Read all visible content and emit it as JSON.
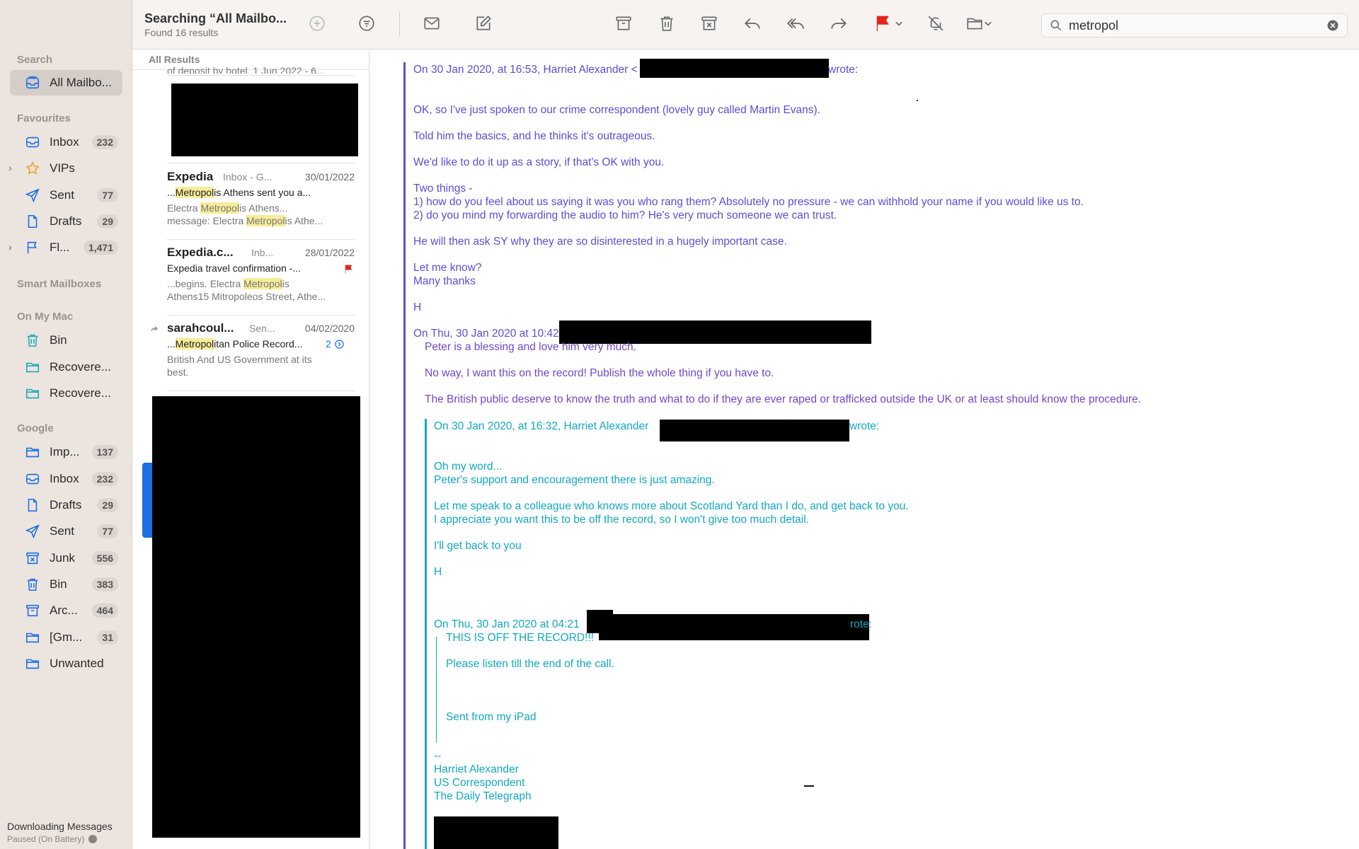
{
  "sidebar": {
    "section_search": "Search",
    "all_mailboxes": "All Mailbo...",
    "section_favourites": "Favourites",
    "fav_inbox": "Inbox",
    "fav_inbox_count": "232",
    "fav_vips": "VIPs",
    "fav_sent": "Sent",
    "fav_sent_count": "77",
    "fav_drafts": "Drafts",
    "fav_drafts_count": "29",
    "fav_flagged": "Fl...",
    "fav_flagged_count": "1,471",
    "section_smart": "Smart Mailboxes",
    "section_mac": "On My Mac",
    "mac_bin": "Bin",
    "mac_recovered1": "Recovere...",
    "mac_recovered2": "Recovere...",
    "section_google": "Google",
    "g_important": "Imp...",
    "g_important_count": "137",
    "g_inbox": "Inbox",
    "g_inbox_count": "232",
    "g_drafts": "Drafts",
    "g_drafts_count": "29",
    "g_sent": "Sent",
    "g_sent_count": "77",
    "g_junk": "Junk",
    "g_junk_count": "556",
    "g_bin": "Bin",
    "g_bin_count": "383",
    "g_archive": "Arc...",
    "g_archive_count": "464",
    "g_gmail": "[Gm...",
    "g_gmail_count": "31",
    "g_unwanted": "Unwanted",
    "status_title": "Downloading Messages",
    "status_sub": "Paused (On Battery)"
  },
  "toolbar": {
    "title": "Searching “All Mailbo...",
    "subtitle": "Found 16 results",
    "search_value": "metropol",
    "flag_color": "#e5251c"
  },
  "list": {
    "header": "All Results",
    "partial_top": "of deposit by hotel. 1 Jun 2022 - 6...",
    "messages": [
      {
        "sender": "Expedia",
        "mailbox": "Inbox - G...",
        "date": "30/01/2022",
        "subj_a": "...",
        "subj_hl": "Metropol",
        "subj_b": "is Athens sent you a...",
        "p1_a": "Electra ",
        "p1_hl": "Metropol",
        "p1_b": "is Athens...",
        "p2_a": "message: Electra ",
        "p2_hl": "Metropol",
        "p2_b": "is Athe..."
      },
      {
        "sender": "Expedia.c...",
        "mailbox": "Inb...",
        "date": "28/01/2022",
        "subj": "Expedia travel confirmation -...",
        "p1_a": "...begins. Electra ",
        "p1_hl": "Metropol",
        "p1_b": "is",
        "p2": "Athens15 Mitropoleos Street, Athe..."
      },
      {
        "sender": "sarahcoul...",
        "mailbox": "Sen...",
        "date": "04/02/2020",
        "subj_a": "...",
        "subj_hl": "Metropol",
        "subj_b": "itan Police Record...",
        "thread_count": "2",
        "p1": "British And US Government at its",
        "p2": "best."
      }
    ]
  },
  "email": {
    "l1a": "On 30 Jan 2020, at 16:53, Harriet Alexander <",
    "l1b": "wrote:",
    "l2": "OK, so I've just spoken to our crime correspondent (lovely guy called Martin Evans).",
    "l3": "Told him the basics, and he thinks it's outrageous.",
    "l4": "We'd like to do it up as a story, if that's OK with you.",
    "l5": "Two things -",
    "l6": "1) how do you feel about us saying it was you who rang them? Absolutely no pressure - we can withhold your name if you would like us to.",
    "l7": "2) do you mind my forwarding the audio to him? He's very much someone we can trust.",
    "l8": "He will then ask SY why they are so disinterested in a hugely important case.",
    "l9": "Let me know?",
    "l10": "Many thanks",
    "l11": "H",
    "l12": "On Thu, 30 Jan 2020 at 10:42",
    "q1": "Peter is a blessing and love him very much.",
    "q2": "No way, I want this on the record! Publish the whole thing if you have to.",
    "q3": "The British public deserve to know the truth and what to do if they are ever raped or trafficked outside the UK or at least should know the procedure.",
    "q4a": "On 30 Jan 2020, at 16:32, Harriet Alexander",
    "q4b": "wrote:",
    "q5": "Oh my word...",
    "q6": "Peter's support and encouragement there is just amazing.",
    "q7": "Let me speak to a colleague who knows more about Scotland Yard than I do, and get back to you.",
    "q8": "I appreciate you want this to be off the record, so I won't give too much detail.",
    "q9": "I'll get back to you",
    "q10": "H",
    "q11a": "On Thu, 30 Jan 2020 at 04:21",
    "q11b": "rote:",
    "r1": "THIS IS OFF THE RECORD!!!",
    "r2": "Please listen till the end of the call.",
    "r3": "Sent from my iPad",
    "s1": "--",
    "s2": "Harriet Alexander",
    "s3": "US Correspondent",
    "s4": "The Daily Telegraph"
  },
  "colors": {
    "level1_text": "#5a4fd6",
    "level2_text": "#13a8c0",
    "selection_blue": "#1b6fe3"
  }
}
